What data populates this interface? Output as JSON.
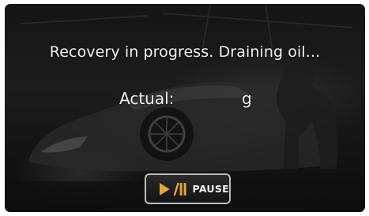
{
  "screen": {
    "message": "Recovery in progress. Draining oil...",
    "actual": {
      "label": "Actual:",
      "value": "",
      "unit": "g"
    }
  },
  "controls": {
    "pause_button": {
      "label": "PAUSE",
      "icon": "play-pause-icon",
      "icon_color": "#e8a43a"
    }
  },
  "colors": {
    "text": "#f2f2f2",
    "background": "#181818",
    "button_border": "#bdbdbd"
  }
}
